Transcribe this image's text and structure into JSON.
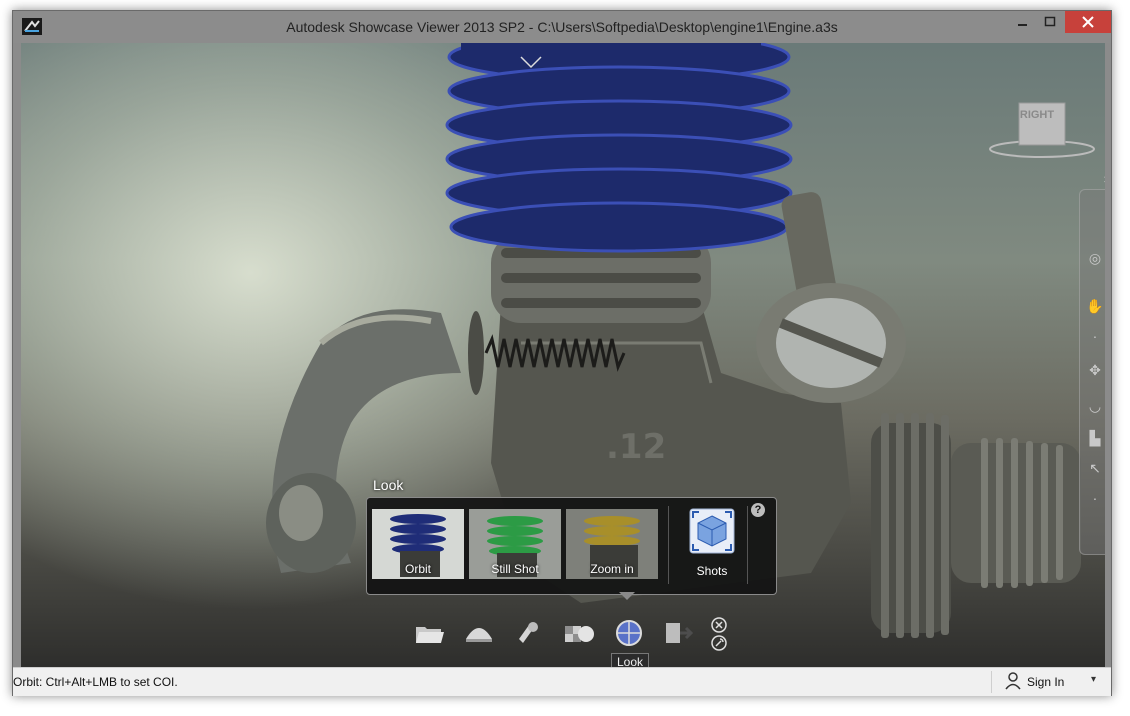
{
  "window": {
    "title": "Autodesk Showcase Viewer 2013 SP2  - C:\\Users\\Softpedia\\Desktop\\engine1\\Engine.a3s",
    "controls": {
      "minimize_icon": "minimize-icon",
      "maximize_icon": "maximize-icon",
      "close_icon": "close-icon"
    },
    "close_color": "#c7413b"
  },
  "view_cube": {
    "face_label": "RIGHT"
  },
  "nav_bar": {
    "items": [
      "steering-wheel-icon",
      "pan-icon",
      "zoom-icon",
      "orbit-icon",
      "look-around-icon",
      "walk-icon",
      "rewind-icon",
      "center-icon"
    ]
  },
  "look_panel": {
    "title": "Look",
    "thumbnails": [
      {
        "label": "Orbit",
        "accent": "#3a4fb0"
      },
      {
        "label": "Still Shot",
        "accent": "#2fa14a"
      },
      {
        "label": "Zoom in",
        "accent": "#b59a2c"
      }
    ],
    "shots_label": "Shots",
    "help_icon": "help-icon"
  },
  "toolbar": {
    "items": [
      "open-folder-icon",
      "environment-dome-icon",
      "lighting-icon",
      "materials-icon",
      "look-icon",
      "exit-icon"
    ],
    "active": "look-icon",
    "tooltip": "Look"
  },
  "status_bar": {
    "message": "Orbit: Ctrl+Alt+LMB to set COI.",
    "sign_in": "Sign In"
  }
}
